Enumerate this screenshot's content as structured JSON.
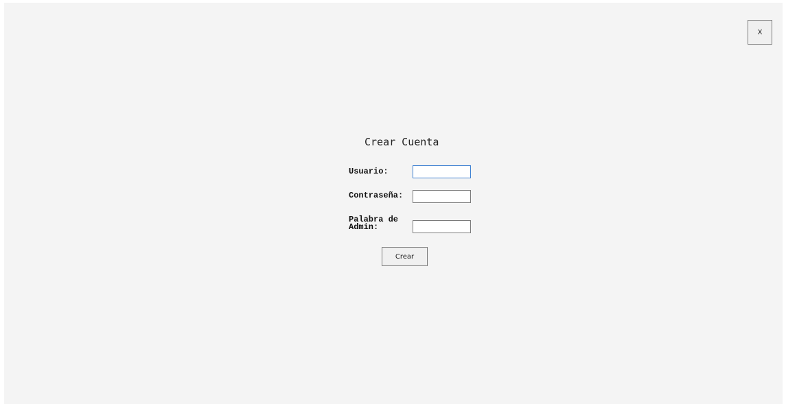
{
  "window": {
    "close_label": "X"
  },
  "form": {
    "title": "Crear Cuenta",
    "username_label": "Usuario:",
    "username_value": "",
    "password_label": "Contraseña:",
    "password_value": "",
    "admin_label": "Palabra de\nAdmin:",
    "admin_value": "",
    "submit_label": "Crear"
  },
  "colors": {
    "background": "#f4f4f4",
    "focused_border": "#3c7fd1",
    "border": "#7a7a7a"
  }
}
